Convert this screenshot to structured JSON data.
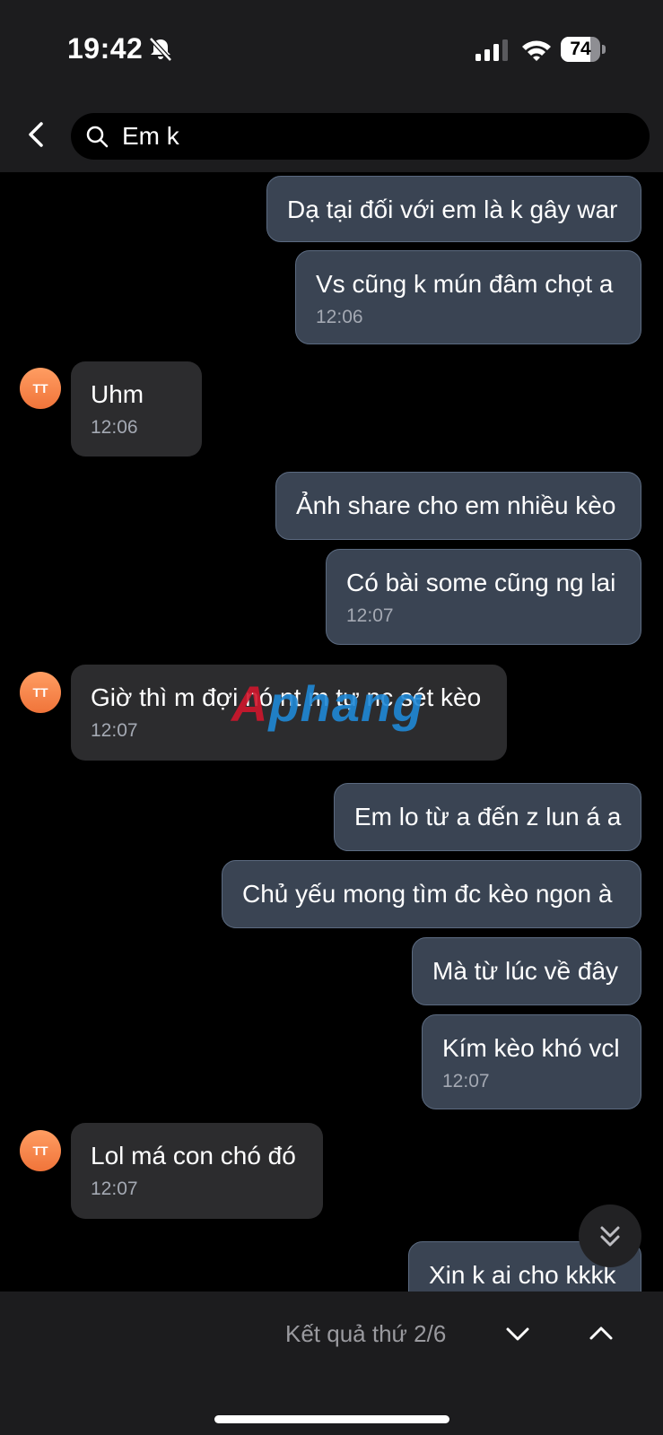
{
  "status_bar": {
    "time": "19:42",
    "battery": "74",
    "battery_level": 0.74
  },
  "header": {
    "search_query": "Em k"
  },
  "messages": [
    {
      "dir": "out",
      "text": "Dạ tại đối với em là k gây war",
      "time": ""
    },
    {
      "dir": "out",
      "text": "Vs cũng k mún đâm chọt a",
      "time": "12:06"
    },
    {
      "dir": "in",
      "avatar": "TT",
      "text": "Uhm",
      "time": "12:06"
    },
    {
      "dir": "out",
      "text": "Ảnh share cho em nhiều kèo",
      "time": ""
    },
    {
      "dir": "out",
      "text": "Có bài some cũng ng lai",
      "time": "12:07"
    },
    {
      "dir": "in",
      "avatar": "TT",
      "text": "Giờ thì m đợi nó nt m tự nc sét kèo",
      "time": "12:07"
    },
    {
      "dir": "out",
      "text": "Em lo từ a đến z lun á a",
      "time": ""
    },
    {
      "dir": "out",
      "text": "Chủ yếu mong tìm đc kèo ngon à",
      "time": ""
    },
    {
      "dir": "out",
      "text": "Mà từ lúc về đây",
      "time": ""
    },
    {
      "dir": "out",
      "text": "Kím kèo khó vcl",
      "time": "12:07"
    },
    {
      "dir": "in",
      "avatar": "TT",
      "text": "Lol má con chó đó",
      "time": "12:07"
    },
    {
      "dir": "out",
      "text": "Xin k ai cho kkkk",
      "time": ""
    }
  ],
  "watermark": {
    "part1": "A",
    "part2": "phang"
  },
  "bottom_bar": {
    "result_text": "Kết quả thứ 2/6"
  },
  "colors": {
    "outgoing_bubble": "#3a4453",
    "incoming_bubble": "#2c2c2e",
    "avatar": "#f0743a",
    "background": "#000000"
  },
  "icons": {
    "back": "chevron-left-icon",
    "search": "search-icon",
    "mute": "bell-slash-icon",
    "scroll_down": "double-chevron-down-icon",
    "prev": "chevron-down-icon",
    "next": "chevron-up-icon"
  }
}
